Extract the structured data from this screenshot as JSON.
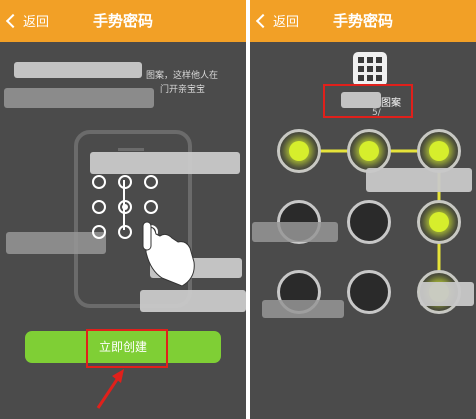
{
  "left_screen": {
    "header": {
      "back_label": "返回",
      "title": "手势密码"
    },
    "status_fragment": "",
    "instruction_line1": "图案，这样他人在",
    "instruction_line2": "门开亲宝宝",
    "create_button_label": "立即创建",
    "colors": {
      "header": "#f2a026",
      "button": "#7fcf35",
      "highlight": "#e0201b",
      "background": "#4b4b4b"
    }
  },
  "right_screen": {
    "header": {
      "back_label": "返回",
      "title": "手势密码"
    },
    "prompt_label": "图案",
    "prompt_suffix": "5/",
    "pattern_grid": {
      "active_nodes": [
        1,
        2,
        3,
        6,
        9
      ]
    },
    "colors": {
      "active_dot": "#d6ee2c",
      "path_line": "#e6e33a"
    }
  }
}
